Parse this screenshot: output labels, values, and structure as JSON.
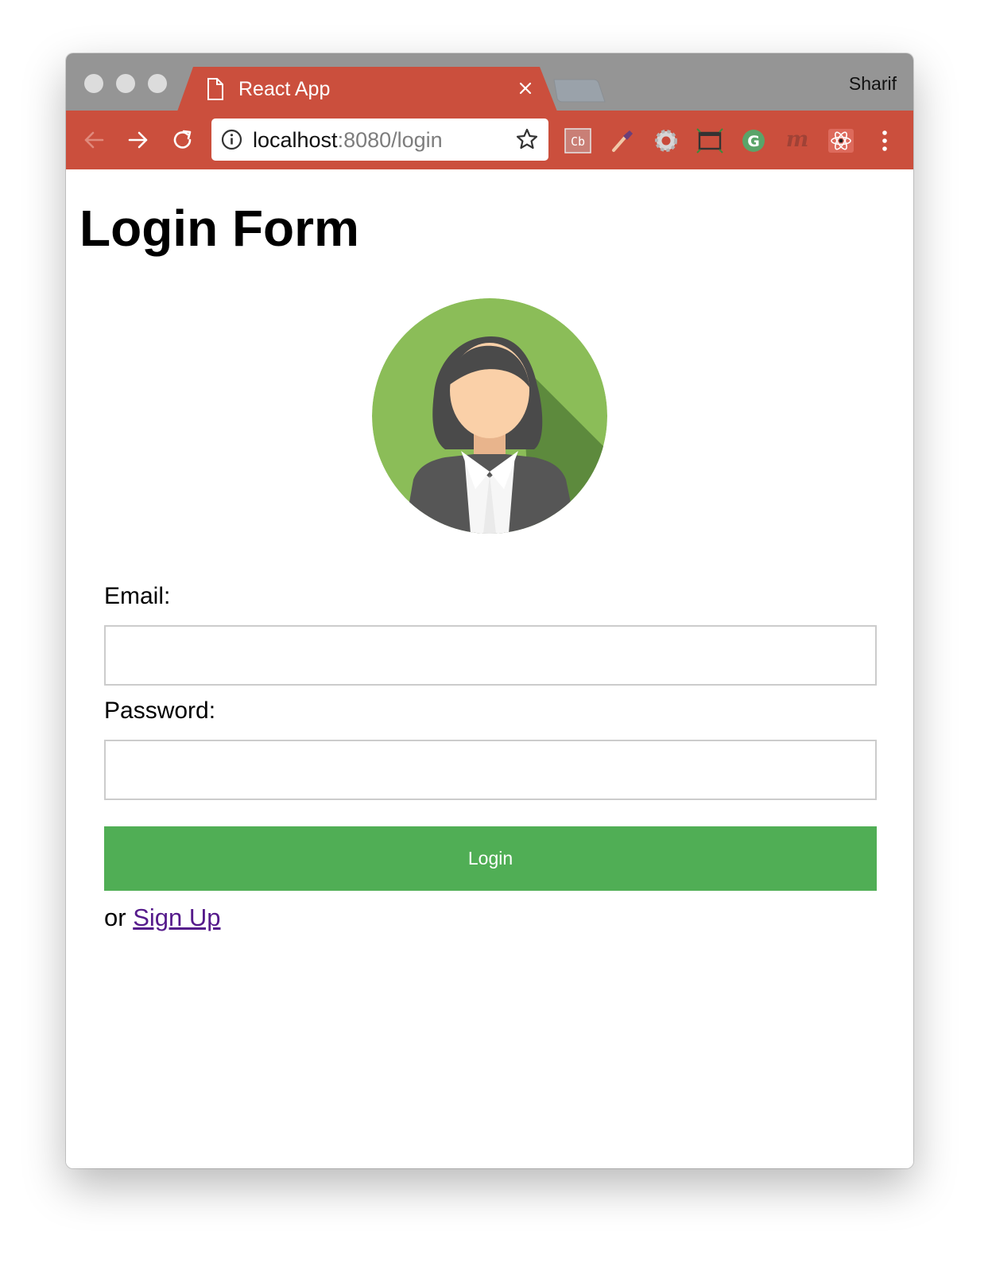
{
  "browser": {
    "tab": {
      "title": "React App",
      "page_icon": "page-icon",
      "close_icon": "close-icon"
    },
    "profile_name": "Sharif",
    "address": {
      "host": "localhost",
      "path": ":8080/login"
    },
    "toolbar_icons": [
      "back-arrow-icon",
      "forward-arrow-icon",
      "reload-icon",
      "info-icon",
      "star-icon"
    ],
    "extensions": [
      {
        "name": "cb-extension-icon",
        "label": "Cb"
      },
      {
        "name": "eyedropper-icon"
      },
      {
        "name": "gear-extension-icon"
      },
      {
        "name": "window-resizer-icon"
      },
      {
        "name": "grammarly-icon",
        "label": "G"
      },
      {
        "name": "m-extension-icon",
        "label": "m"
      },
      {
        "name": "react-devtools-icon"
      },
      {
        "name": "more-menu-icon"
      }
    ],
    "accent_color": "#cb4f3d"
  },
  "page": {
    "title": "Login Form",
    "avatar": "woman-avatar-icon",
    "form": {
      "email_label": "Email:",
      "email_value": "",
      "password_label": "Password:",
      "password_value": "",
      "login_label": "Login",
      "login_color": "#50ae55",
      "signup_prefix": "or",
      "signup_link": "Sign Up"
    }
  }
}
